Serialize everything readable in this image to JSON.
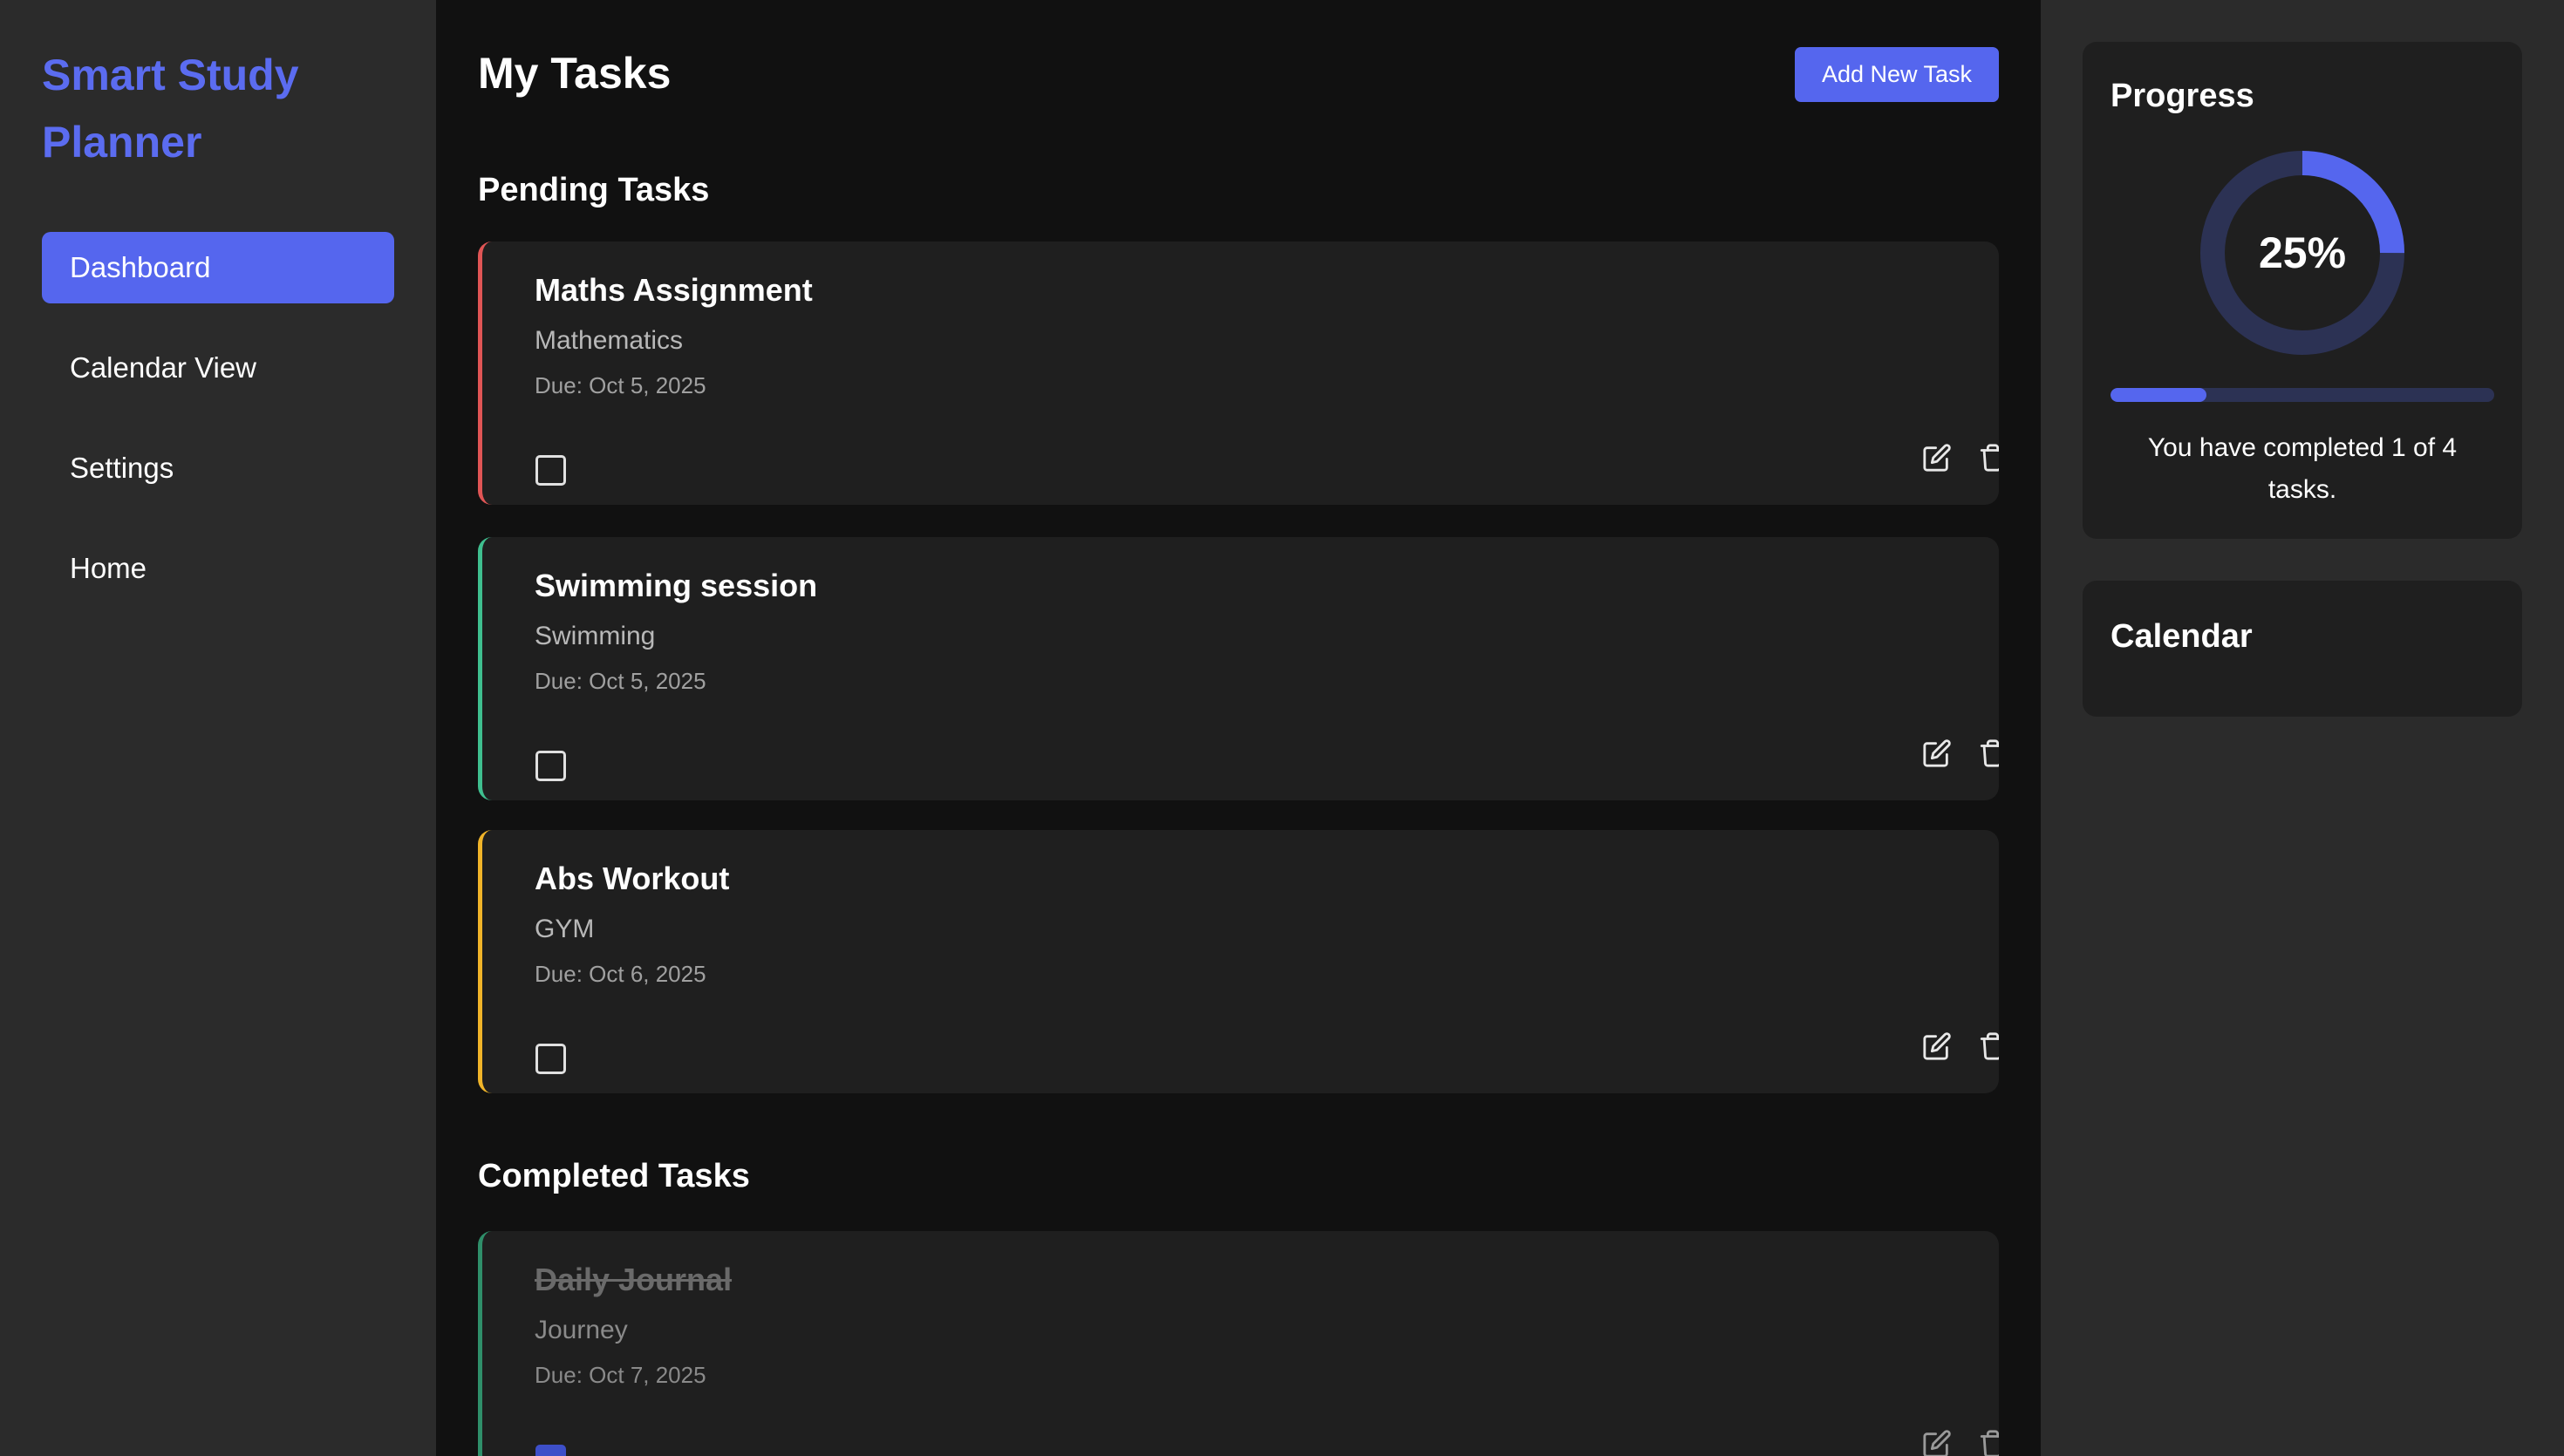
{
  "sidebar": {
    "brand": "Smart Study Planner",
    "nav": [
      {
        "label": "Dashboard",
        "active": true
      },
      {
        "label": "Calendar View",
        "active": false
      },
      {
        "label": "Settings",
        "active": false
      },
      {
        "label": "Home",
        "active": false
      }
    ]
  },
  "main": {
    "title": "My Tasks",
    "add_button_label": "Add New Task",
    "pending_heading": "Pending Tasks",
    "completed_heading": "Completed Tasks",
    "pending_tasks": [
      {
        "title": "Maths Assignment",
        "subject": "Mathematics",
        "due": "Due: Oct 5, 2025",
        "accent": "#e05555",
        "done": false
      },
      {
        "title": "Swimming session",
        "subject": "Swimming",
        "due": "Due: Oct 5, 2025",
        "accent": "#3fbf8f",
        "done": false
      },
      {
        "title": "Abs Workout",
        "subject": "GYM",
        "due": "Due: Oct 6, 2025",
        "accent": "#f0b429",
        "done": false
      }
    ],
    "completed_tasks": [
      {
        "title": "Daily Journal",
        "subject": "Journey",
        "due": "Due: Oct 7, 2025",
        "accent": "#2f8f6a",
        "done": true
      }
    ]
  },
  "progress": {
    "title": "Progress",
    "percent_label": "25%",
    "fraction": 0.25,
    "text": "You have completed 1 of 4 tasks."
  },
  "calendar": {
    "title": "Calendar"
  },
  "colors": {
    "accent": "#5566ee",
    "brand": "#5b6cf0",
    "ring_track": "#2c3254"
  },
  "icons": {
    "edit": "edit-icon",
    "delete": "trash-icon"
  }
}
